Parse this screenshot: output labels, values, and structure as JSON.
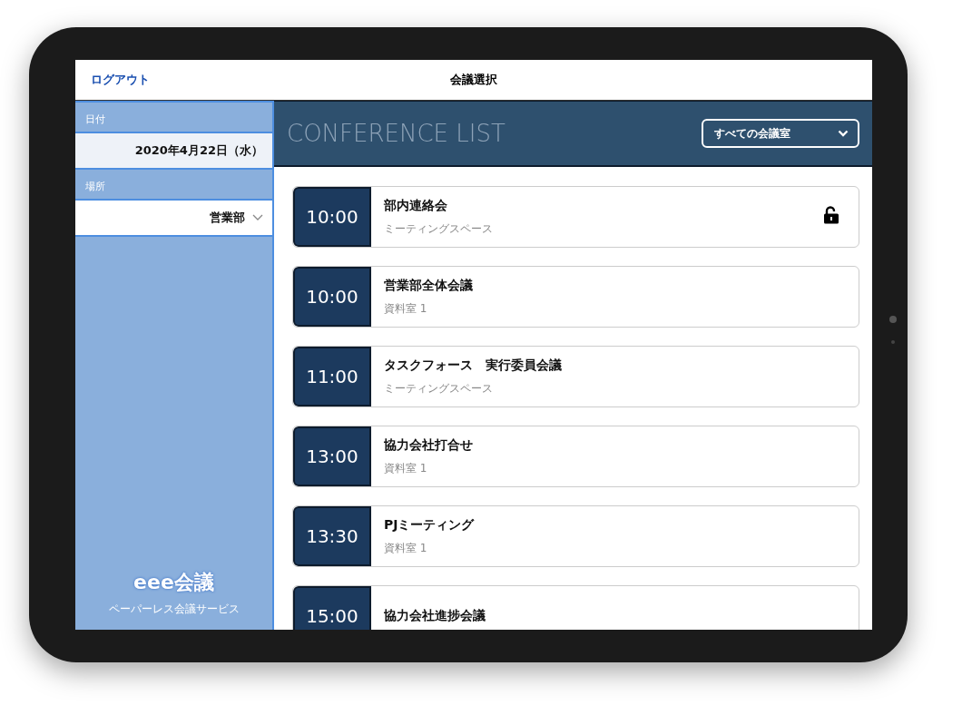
{
  "header": {
    "logout": "ログアウト",
    "title": "会議選択"
  },
  "sidebar": {
    "date_label": "日付",
    "date_value": "2020年4月22日（水）",
    "place_label": "場所",
    "place_value": "営業部",
    "logo": "eee会議",
    "logo_tagline": "ペーパーレス会議サービス"
  },
  "conference_list": {
    "title": "CONFERENCE LIST",
    "room_filter": "すべての会議室"
  },
  "meetings": [
    {
      "time": "10:00",
      "name": "部内連絡会",
      "room": "ミーティングスペース",
      "locked": true
    },
    {
      "time": "10:00",
      "name": "営業部全体会議",
      "room": "資料室 1",
      "locked": false
    },
    {
      "time": "11:00",
      "name": "タスクフォース　実行委員会議",
      "room": "ミーティングスペース",
      "locked": false
    },
    {
      "time": "13:00",
      "name": "協力会社打合せ",
      "room": "資料室 1",
      "locked": false
    },
    {
      "time": "13:30",
      "name": "PJミーティング",
      "room": "資料室 1",
      "locked": false
    },
    {
      "time": "15:00",
      "name": "協力会社進捗会議",
      "locked": false
    }
  ]
}
